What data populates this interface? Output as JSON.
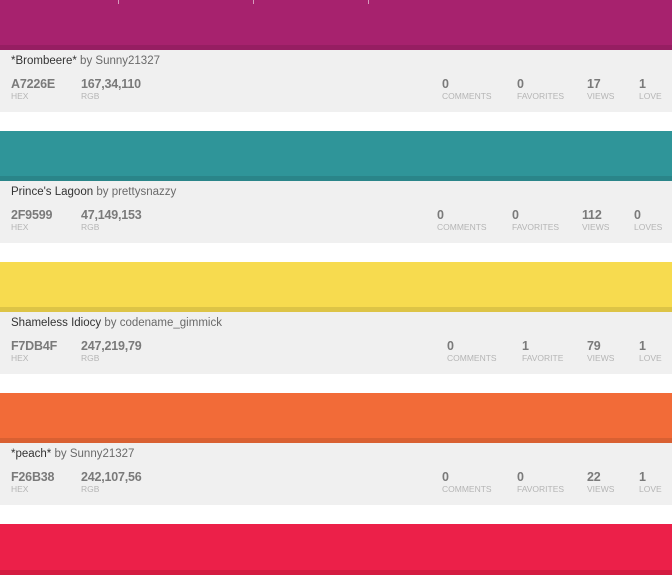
{
  "palettes": [
    {
      "title": "*Brombeere*",
      "by_label": "by",
      "author": "Sunny21327",
      "color": "#A7226E",
      "hex": "A7226E",
      "rgb": "167,34,110",
      "hex_label": "HEX",
      "rgb_label": "RGB",
      "stats": [
        {
          "value": "0",
          "label": "COMMENTS"
        },
        {
          "value": "0",
          "label": "FAVORITES"
        },
        {
          "value": "17",
          "label": "VIEWS"
        },
        {
          "value": "1",
          "label": "LOVE"
        }
      ]
    },
    {
      "title": "Prince's Lagoon",
      "by_label": "by",
      "author": "prettysnazzy",
      "color": "#2F9599",
      "hex": "2F9599",
      "rgb": "47,149,153",
      "hex_label": "HEX",
      "rgb_label": "RGB",
      "stats": [
        {
          "value": "0",
          "label": "COMMENTS"
        },
        {
          "value": "0",
          "label": "FAVORITES"
        },
        {
          "value": "112",
          "label": "VIEWS"
        },
        {
          "value": "0",
          "label": "LOVES"
        }
      ]
    },
    {
      "title": "Shameless Idiocy",
      "by_label": "by",
      "author": "codename_gimmick",
      "color": "#F7DB4F",
      "hex": "F7DB4F",
      "rgb": "247,219,79",
      "hex_label": "HEX",
      "rgb_label": "RGB",
      "stats": [
        {
          "value": "0",
          "label": "COMMENTS"
        },
        {
          "value": "1",
          "label": "FAVORITE"
        },
        {
          "value": "79",
          "label": "VIEWS"
        },
        {
          "value": "1",
          "label": "LOVE"
        }
      ]
    },
    {
      "title": "*peach*",
      "by_label": "by",
      "author": "Sunny21327",
      "color": "#F26B38",
      "hex": "F26B38",
      "rgb": "242,107,56",
      "hex_label": "HEX",
      "rgb_label": "RGB",
      "stats": [
        {
          "value": "0",
          "label": "COMMENTS"
        },
        {
          "value": "0",
          "label": "FAVORITES"
        },
        {
          "value": "22",
          "label": "VIEWS"
        },
        {
          "value": "1",
          "label": "LOVE"
        }
      ]
    }
  ],
  "next_palette_color": "#EC2049"
}
